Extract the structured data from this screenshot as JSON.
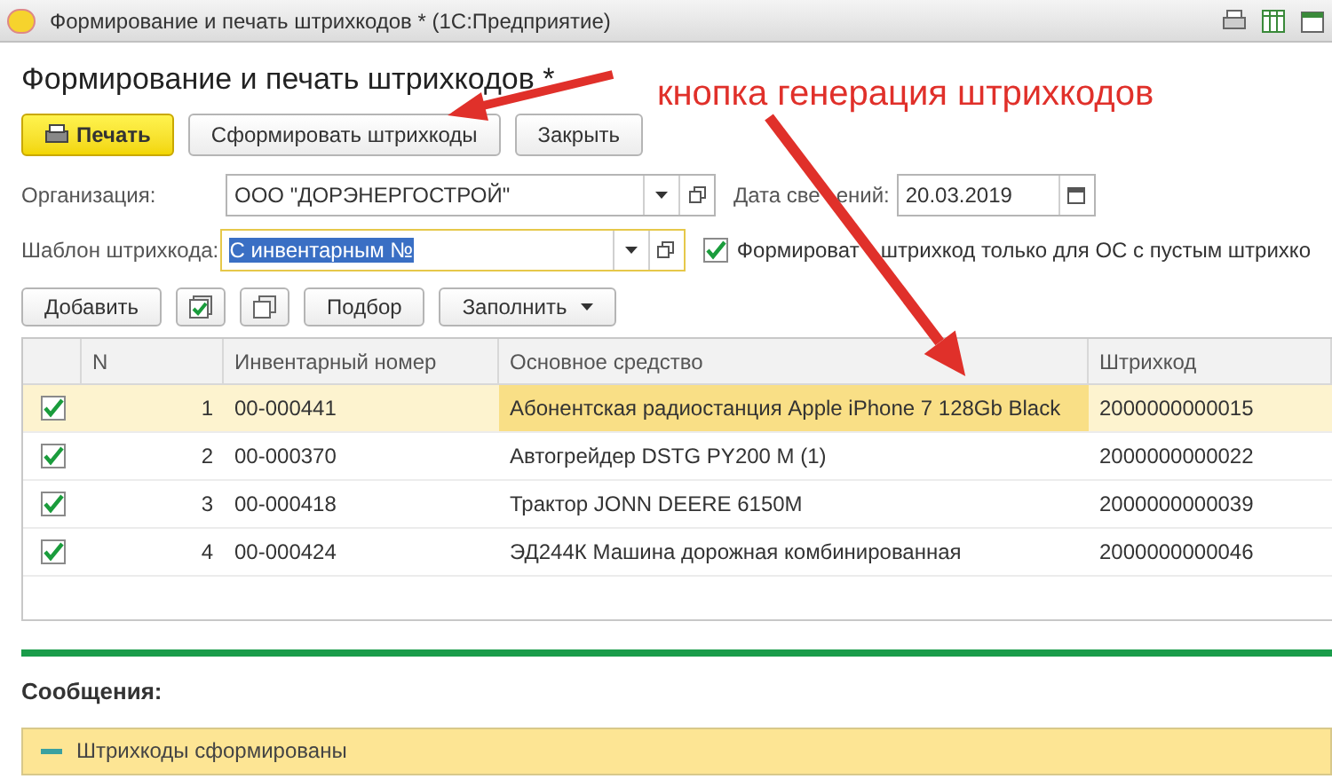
{
  "window": {
    "title": "Формирование и печать штрихкодов * (1С:Предприятие)"
  },
  "form_title": "Формирование и печать штрихкодов *",
  "annotation": "кнопка генерация штрихкодов",
  "command_bar": [
    {
      "label": "Печать",
      "kind": "primary"
    },
    {
      "label": "Сформировать штрихкоды",
      "kind": "normal"
    },
    {
      "label": "Закрыть",
      "kind": "normal"
    }
  ],
  "organization": {
    "label": "Организация:",
    "value": "ООО \"ДОРЭНЕРГОСТРОЙ\""
  },
  "date": {
    "label_parts": [
      "Дата све",
      "ений:"
    ],
    "value": "20.03.2019"
  },
  "template": {
    "label": "Шаблон штрихкода:",
    "value": "С инвентарным №",
    "focused": true
  },
  "only_empty": {
    "label_parts": [
      "Формироват",
      "штрихкод только для ОС с пустым штрихко"
    ],
    "checked": true
  },
  "table_toolbar": [
    {
      "label": "Добавить",
      "kind": "text"
    },
    {
      "kind": "check-all"
    },
    {
      "kind": "copy"
    },
    {
      "label": "Подбор",
      "kind": "text"
    },
    {
      "label": "Заполнить",
      "kind": "menu"
    }
  ],
  "table": {
    "columns": [
      "N",
      "Инвентарный номер",
      "Основное средство",
      "Штрихкод"
    ],
    "rows": [
      {
        "checked": true,
        "selected": true,
        "n": "1",
        "inventory": "00-000441",
        "asset": "Абонентская радиостанция Apple iPhone 7 128Gb Black",
        "barcode": "2000000000015"
      },
      {
        "checked": true,
        "selected": false,
        "n": "2",
        "inventory": "00-000370",
        "asset": "Автогрейдер DSTG PY200 M (1)",
        "barcode": "2000000000022"
      },
      {
        "checked": true,
        "selected": false,
        "n": "3",
        "inventory": "00-000418",
        "asset": "Трактор JONN DEERE 6150M",
        "barcode": "2000000000039"
      },
      {
        "checked": true,
        "selected": false,
        "n": "4",
        "inventory": "00-000424",
        "asset": "ЭД244К Машина дорожная комбинированная",
        "barcode": "2000000000046"
      }
    ]
  },
  "messages": {
    "title": "Сообщения:",
    "items": [
      {
        "text": "Штрихкоды сформированы",
        "expanded": true
      }
    ]
  }
}
